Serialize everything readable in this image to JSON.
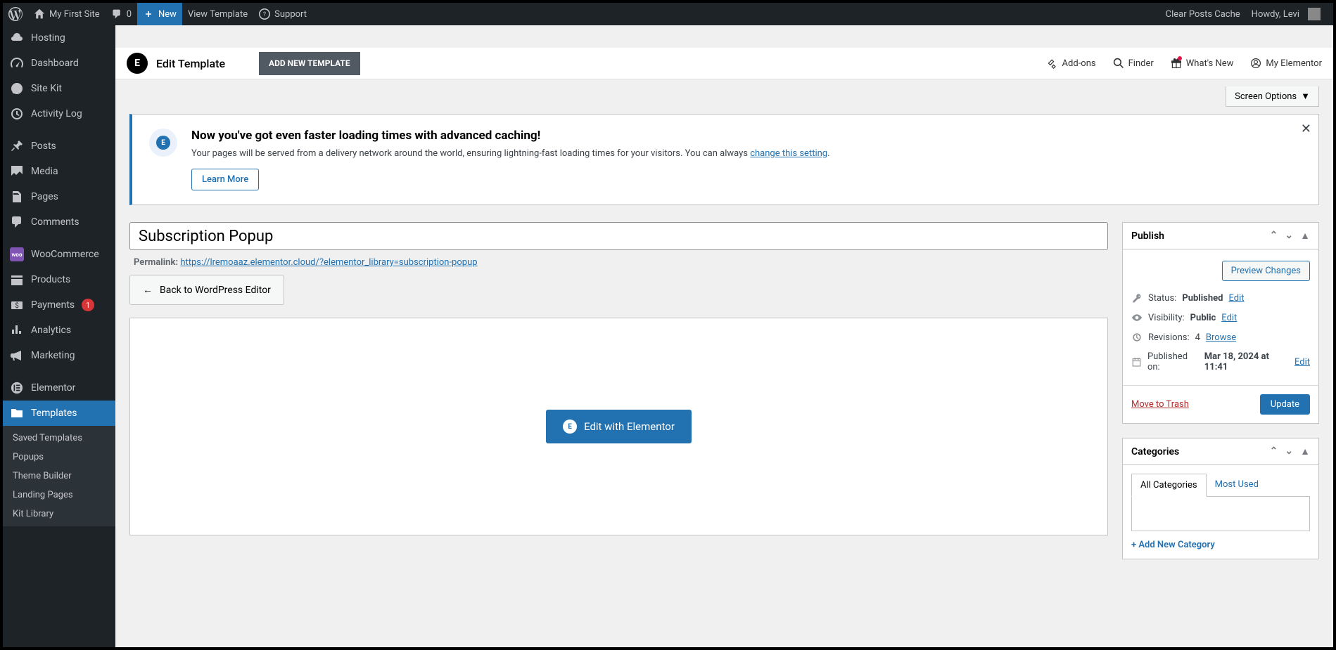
{
  "adminBar": {
    "siteName": "My First Site",
    "comments": "0",
    "new": "New",
    "viewTemplate": "View Template",
    "support": "Support",
    "clearCache": "Clear Posts Cache",
    "howdy": "Howdy, Levi"
  },
  "sidebar": {
    "hosting": "Hosting",
    "dashboard": "Dashboard",
    "siteKit": "Site Kit",
    "activityLog": "Activity Log",
    "posts": "Posts",
    "media": "Media",
    "pages": "Pages",
    "comments": "Comments",
    "woo": "WooCommerce",
    "products": "Products",
    "payments": "Payments",
    "paymentsBadge": "1",
    "analytics": "Analytics",
    "marketing": "Marketing",
    "elementor": "Elementor",
    "templates": "Templates",
    "sub": {
      "saved": "Saved Templates",
      "popups": "Popups",
      "theme": "Theme Builder",
      "landing": "Landing Pages",
      "kit": "Kit Library"
    }
  },
  "header": {
    "editTemplate": "Edit Template",
    "addNew": "ADD NEW TEMPLATE",
    "addons": "Add-ons",
    "finder": "Finder",
    "whatsNew": "What's New",
    "myElementor": "My Elementor"
  },
  "screenOptions": "Screen Options",
  "notice": {
    "title": "Now you've got even faster loading times with advanced caching!",
    "body": "Your pages will be served from a delivery network around the world, ensuring lightning-fast loading times for your visitors. You can always ",
    "link": "change this setting",
    "learnMore": "Learn More"
  },
  "title": "Subscription Popup",
  "permalink": {
    "label": "Permalink:",
    "url": "https://lremoaaz.elementor.cloud/?elementor_library=subscription-popup"
  },
  "backBtn": "Back to WordPress Editor",
  "editWith": "Edit with Elementor",
  "publish": {
    "heading": "Publish",
    "preview": "Preview Changes",
    "statusLabel": "Status:",
    "statusVal": "Published",
    "visLabel": "Visibility:",
    "visVal": "Public",
    "revLabel": "Revisions:",
    "revVal": "4",
    "browse": "Browse",
    "pubLabel": "Published on:",
    "pubVal": "Mar 18, 2024 at 11:41",
    "edit": "Edit",
    "trash": "Move to Trash",
    "update": "Update"
  },
  "categories": {
    "heading": "Categories",
    "all": "All Categories",
    "mostUsed": "Most Used",
    "addNew": "+ Add New Category"
  }
}
